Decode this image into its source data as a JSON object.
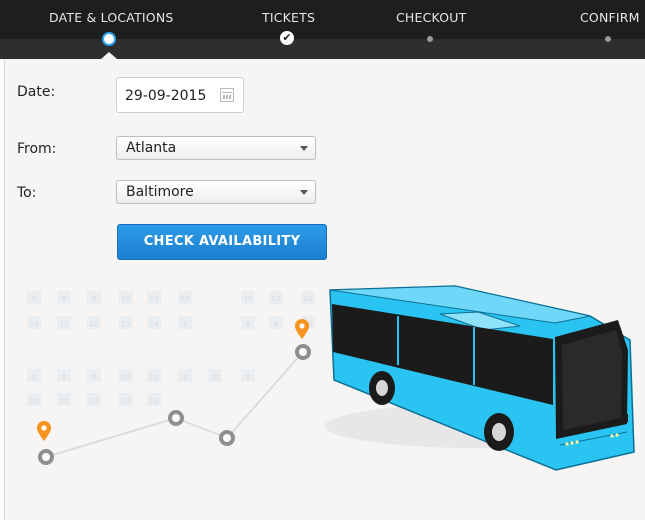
{
  "wizard": {
    "steps": [
      {
        "label": "DATE & LOCATIONS",
        "state": "current"
      },
      {
        "label": "TICKETS",
        "state": "done"
      },
      {
        "label": "CHECKOUT",
        "state": "todo"
      },
      {
        "label": "CONFIRM",
        "state": "todo"
      }
    ],
    "done_icon": "✔"
  },
  "form": {
    "date_label": "Date:",
    "date_value": "29-09-2015",
    "from_label": "From:",
    "from_value": "Atlanta",
    "to_label": "To:",
    "to_value": "Baltimore",
    "submit_label": "CHECK AVAILABILITY"
  },
  "colors": {
    "accent": "#2ea3ee",
    "bus": "#29c4f2",
    "pin": "#f7941d",
    "route": "#8f8f8f"
  },
  "illustration": {
    "calendar_numbers": [
      "1",
      "8",
      "9",
      "10",
      "11",
      "12",
      "12",
      "13",
      "14",
      "1",
      "8",
      "9",
      "10",
      "11",
      "12",
      "12",
      "13",
      "14",
      "1",
      "8",
      "9",
      "10",
      "11",
      "12",
      "1",
      "8",
      "9",
      "10",
      "11"
    ]
  }
}
